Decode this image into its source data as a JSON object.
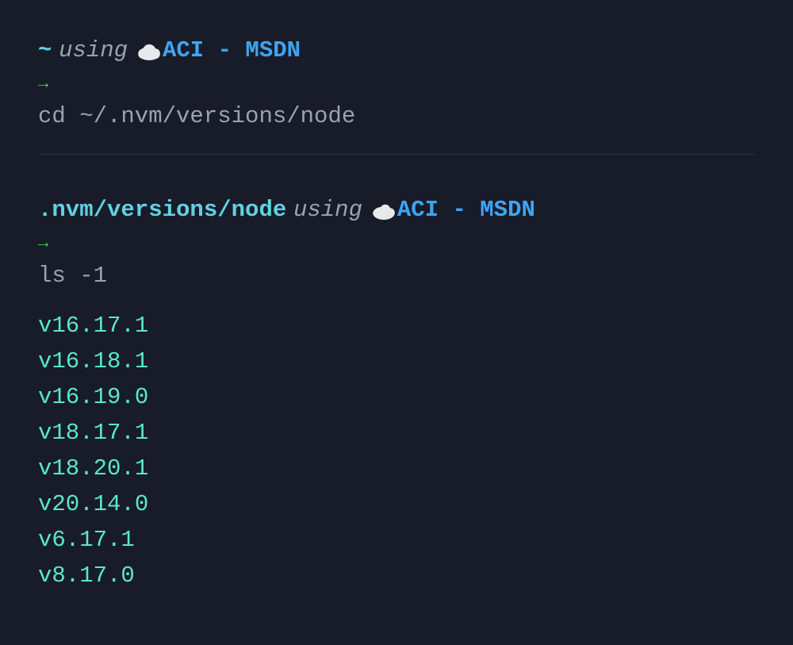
{
  "block1": {
    "prompt_path": "~",
    "using_word": "using",
    "context": "ACI - MSDN",
    "arrow": "→",
    "command": "cd ~/.nvm/versions/node"
  },
  "block2": {
    "prompt_path": ".nvm/versions/node",
    "using_word": "using",
    "context": "ACI - MSDN",
    "arrow": "→",
    "command": "ls -1",
    "output": [
      "v16.17.1",
      "v16.18.1",
      "v16.19.0",
      "v18.17.1",
      "v18.20.1",
      "v20.14.0",
      "v6.17.1",
      "v8.17.0"
    ]
  }
}
